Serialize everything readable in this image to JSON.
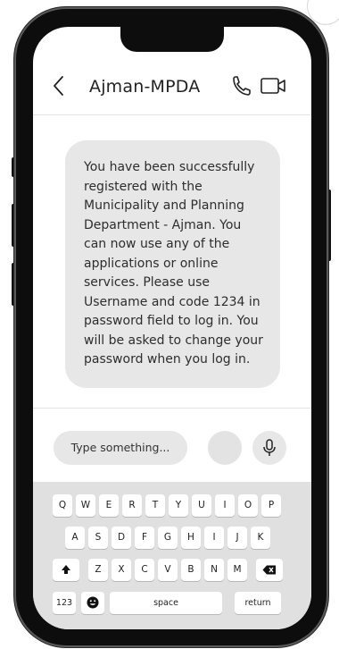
{
  "header": {
    "contact_name": "Ajman-MPDA"
  },
  "message": {
    "text": "You have been successfully registered with the Municipality and Planning Department - Ajman. You can now use any of the applications or online services. Please use Username and code 1234 in password field to log in. You will be asked to change your password when you log in."
  },
  "composer": {
    "placeholder": "Type something..."
  },
  "keyboard": {
    "row1": [
      "Q",
      "W",
      "E",
      "R",
      "T",
      "Y",
      "U",
      "I",
      "O",
      "P"
    ],
    "row2": [
      "A",
      "S",
      "D",
      "F",
      "G",
      "H",
      "I",
      "J",
      "K"
    ],
    "row3": [
      "Z",
      "X",
      "C",
      "V",
      "B",
      "N",
      "M"
    ],
    "numbers_label": "123",
    "space_label": "space",
    "return_label": "return"
  },
  "icons": {
    "back": "chevron-left-icon",
    "call": "phone-icon",
    "video": "video-camera-icon",
    "mic": "microphone-icon",
    "shift": "shift-arrow-icon",
    "delete": "backspace-icon",
    "emoji": "emoji-icon"
  }
}
